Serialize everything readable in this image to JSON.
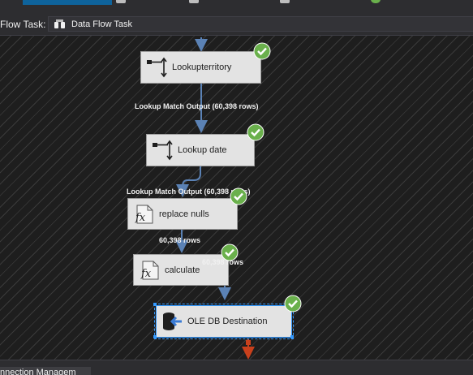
{
  "toolbar": {
    "task_label": "Flow Task:",
    "task_value": "Data Flow Task"
  },
  "nodes": [
    {
      "label": "Lookupterritory",
      "icon": "lookup-icon",
      "status": "success"
    },
    {
      "label": "Lookup date",
      "icon": "lookup-icon",
      "status": "success"
    },
    {
      "label": "replace nulls",
      "icon": "derived-column-icon",
      "status": "success"
    },
    {
      "label": "calculate",
      "icon": "derived-column-icon",
      "status": "success"
    },
    {
      "label": "OLE DB Destination",
      "icon": "ole-db-destination-icon",
      "status": "success",
      "selected": true
    }
  ],
  "paths": [
    {
      "label": "Lookup Match Output (60,398 rows)"
    },
    {
      "label": "Lookup Match Output (60,398 rows)"
    },
    {
      "label": "60,398 rows"
    },
    {
      "label": "60,398 rows"
    }
  ],
  "bottom": {
    "tab_label": "nnection Managem"
  },
  "colors": {
    "success": "#6ab04c",
    "selection": "#3399ff",
    "error_output": "#c8401c",
    "path": "#5b82b5"
  }
}
